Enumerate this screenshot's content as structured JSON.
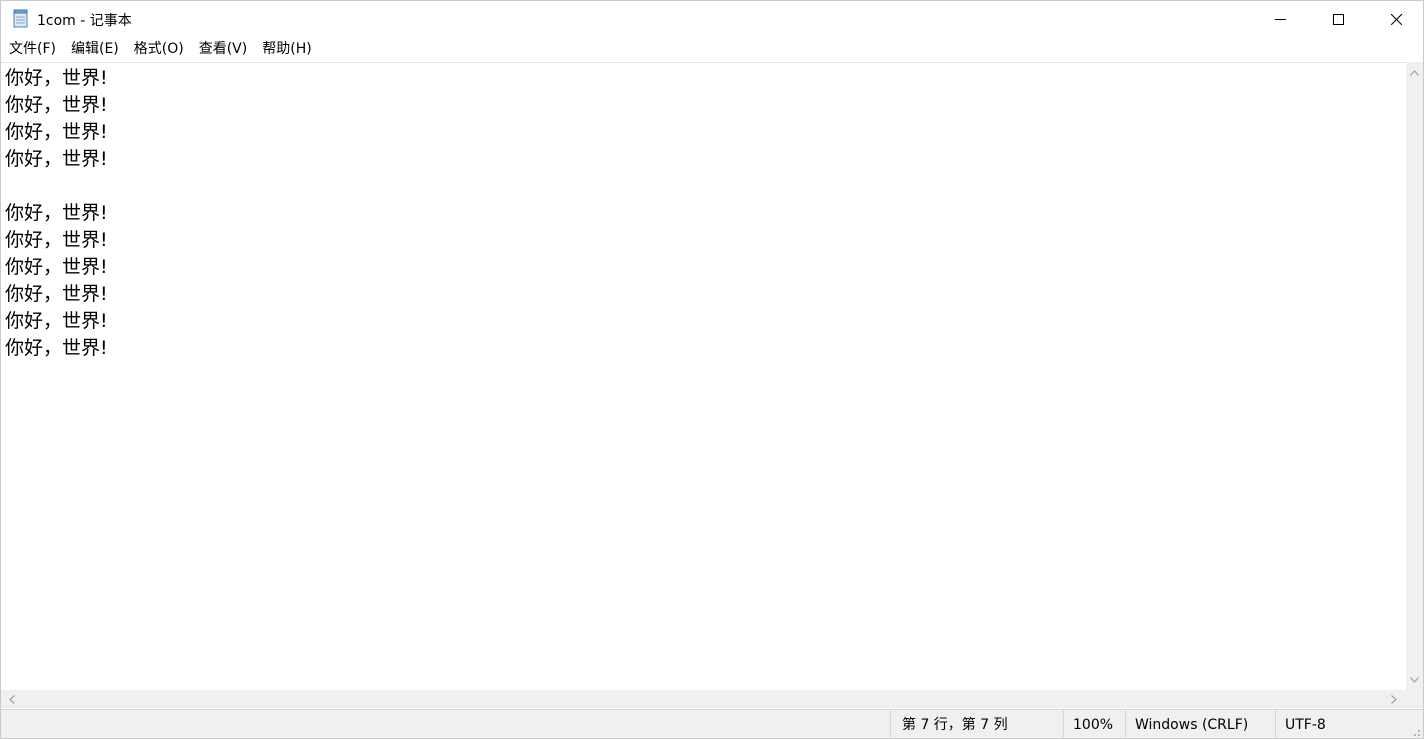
{
  "window": {
    "title": "1com - 记事本"
  },
  "titlebar": {
    "app_icon": "notepad-icon",
    "minimize_icon": "minimize-icon",
    "maximize_icon": "maximize-icon",
    "close_icon": "close-icon"
  },
  "menu": {
    "items": [
      {
        "label": "文件(F)"
      },
      {
        "label": "编辑(E)"
      },
      {
        "label": "格式(O)"
      },
      {
        "label": "查看(V)"
      },
      {
        "label": "帮助(H)"
      }
    ]
  },
  "editor": {
    "lines": [
      "你好，世界!",
      "你好，世界!",
      "你好，世界!",
      "你好，世界!",
      "",
      "你好，世界!",
      "你好，世界!",
      "你好，世界!",
      "你好，世界!",
      "你好，世界!",
      "你好，世界!"
    ]
  },
  "statusbar": {
    "position": "第 7 行，第 7 列",
    "zoom": "100%",
    "line_ending": "Windows (CRLF)",
    "encoding": "UTF-8"
  },
  "colors": {
    "chrome_background": "#f0f0f0",
    "text": "#000000",
    "border": "#d7d7d7"
  }
}
